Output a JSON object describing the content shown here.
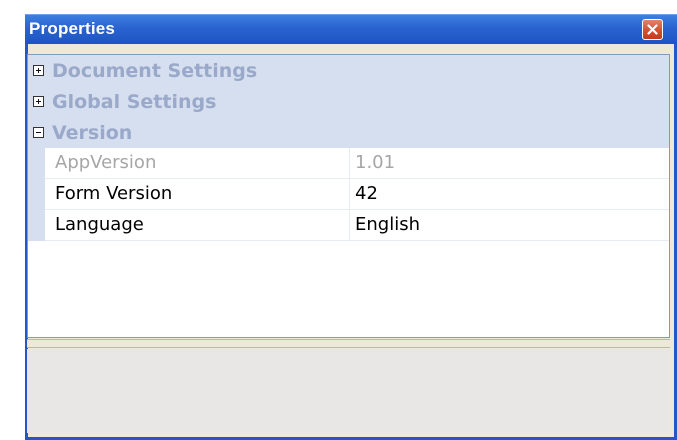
{
  "window": {
    "title": "Properties",
    "close_icon": "close-icon"
  },
  "categories": [
    {
      "label": "Document Settings",
      "state": "collapsed",
      "icon": "expand-plus-icon"
    },
    {
      "label": "Global Settings",
      "state": "collapsed",
      "icon": "expand-plus-icon"
    },
    {
      "label": "Version",
      "state": "expanded",
      "icon": "collapse-minus-icon"
    }
  ],
  "version_properties": [
    {
      "name": "AppVersion",
      "value": "1.01",
      "readonly": true
    },
    {
      "name": "Form Version",
      "value": "42",
      "readonly": false
    },
    {
      "name": "Language",
      "value": "English",
      "readonly": false
    }
  ],
  "description": {
    "text": ""
  },
  "colors": {
    "titlebar": "#2a63cf",
    "category_bg": "#d6dff0",
    "category_text": "#9aa9c9",
    "close_button": "#d5502e",
    "readonly_text": "#a6a6a6"
  }
}
